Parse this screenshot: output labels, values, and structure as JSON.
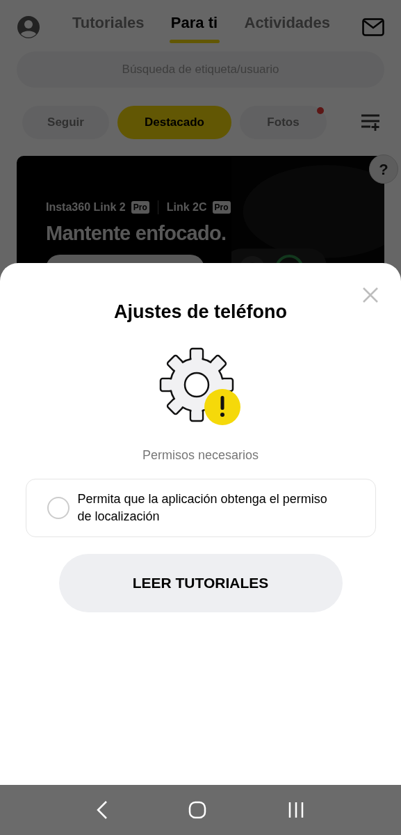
{
  "header": {
    "tabs": [
      {
        "label": "Tutoriales",
        "selected": false
      },
      {
        "label": "Para ti",
        "selected": true
      },
      {
        "label": "Actividades",
        "selected": false
      }
    ]
  },
  "search": {
    "placeholder": "Búsqueda de etiqueta/usuario"
  },
  "filters": [
    {
      "label": "Seguir",
      "selected": false,
      "unread": false
    },
    {
      "label": "Destacado",
      "selected": true,
      "unread": false
    },
    {
      "label": "Fotos",
      "selected": false,
      "unread": true
    }
  ],
  "help_button": "?",
  "banner": {
    "products": [
      {
        "name": "Insta360 Link 2",
        "badge": "Pro"
      },
      {
        "name": "Link 2C",
        "badge": "Pro"
      }
    ],
    "headline": "Mantente enfocado."
  },
  "dialog": {
    "title": "Ajustes de teléfono",
    "subtitle": "Permisos necesarios",
    "permissions": [
      {
        "text": "Permita que la aplicación obtenga el permiso de localización",
        "checked": false
      }
    ],
    "button": "LEER TUTORIALES"
  }
}
